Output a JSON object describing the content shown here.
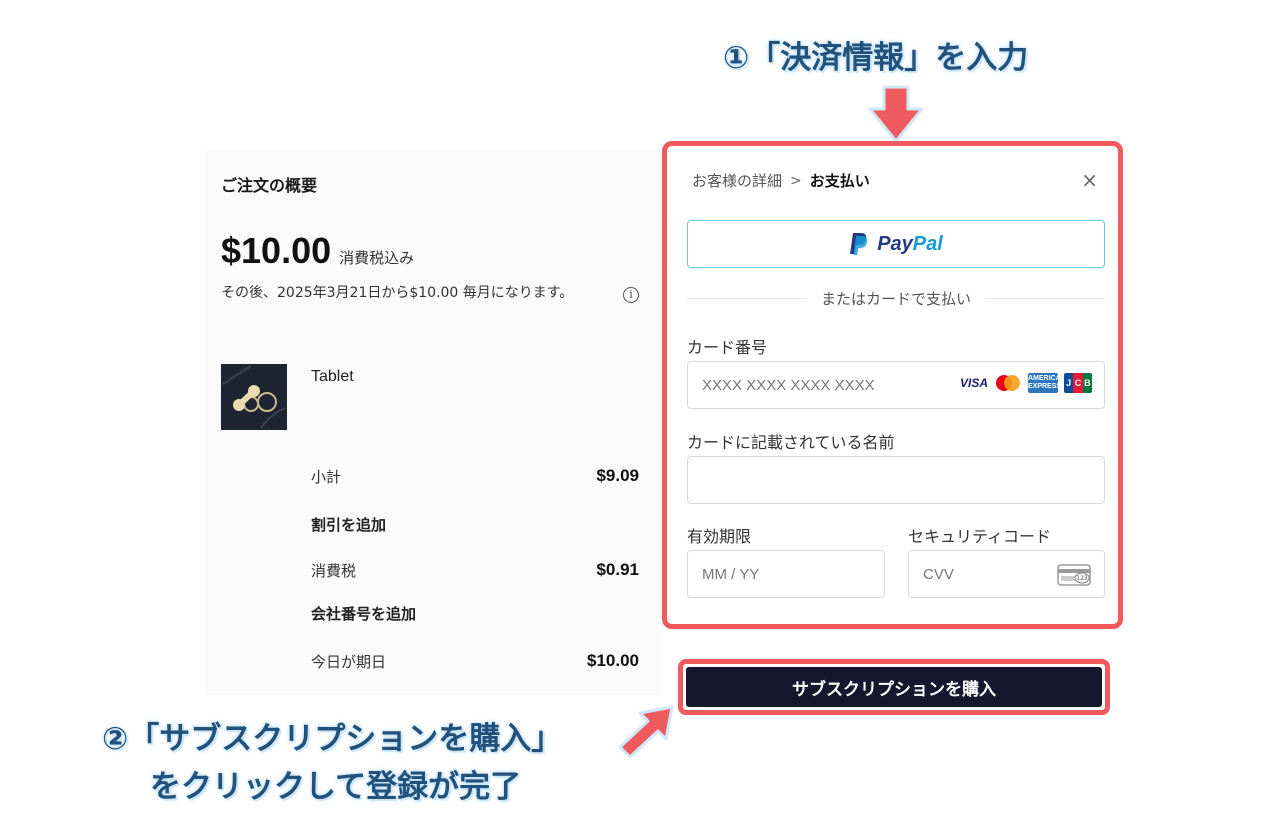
{
  "annotations": {
    "step1": "①「決済情報」を入力",
    "step2_line1": "②「サブスクリプションを購入」",
    "step2_line2": "をクリックして登録が完了"
  },
  "order_summary": {
    "title": "ご注文の概要",
    "price": "$10.00",
    "price_note": "消費税込み",
    "after_note": "その後、2025年3月21日から$10.00 毎月になります。",
    "product_name": "Tablet",
    "subtotal_label": "小計",
    "subtotal_value": "$9.09",
    "add_discount": "割引を追加",
    "tax_label": "消費税",
    "tax_value": "$0.91",
    "add_company_number": "会社番号を追加",
    "due_today_label": "今日が期日",
    "due_today_value": "$10.00"
  },
  "payment": {
    "breadcrumb_details": "お客様の詳細",
    "breadcrumb_sep": ">",
    "breadcrumb_current": "お支払い",
    "close": "×",
    "paypal_pay": "Pay",
    "paypal_pal": "Pal",
    "divider_text": "またはカードで支払い",
    "card_number_label": "カード番号",
    "card_number_placeholder": "XXXX XXXX XXXX XXXX",
    "cardholder_label": "カードに記載されている名前",
    "cardholder_value": "",
    "expiry_label": "有効期限",
    "expiry_placeholder": "MM / YY",
    "security_label": "セキュリティコード",
    "security_placeholder": "CVV",
    "card_brands": {
      "visa": "VISA",
      "amex": "AMERICAN EXPRESS",
      "jcb": "JCB",
      "cvv_icon_text": "123"
    }
  },
  "buy_button": "サブスクリプションを購入",
  "colors": {
    "highlight": "#ef5a5f",
    "buy_button_bg": "#16162e",
    "annotation_text": "#22517c",
    "paypal_dark": "#253b80",
    "paypal_light": "#179bd7"
  },
  "icons": [
    "info-icon",
    "close-icon",
    "paypal-logo-icon",
    "visa-icon",
    "mastercard-icon",
    "amex-icon",
    "jcb-icon",
    "cvv-card-icon",
    "arrow-down-icon",
    "arrow-pointer-icon",
    "product-logo-icon"
  ]
}
